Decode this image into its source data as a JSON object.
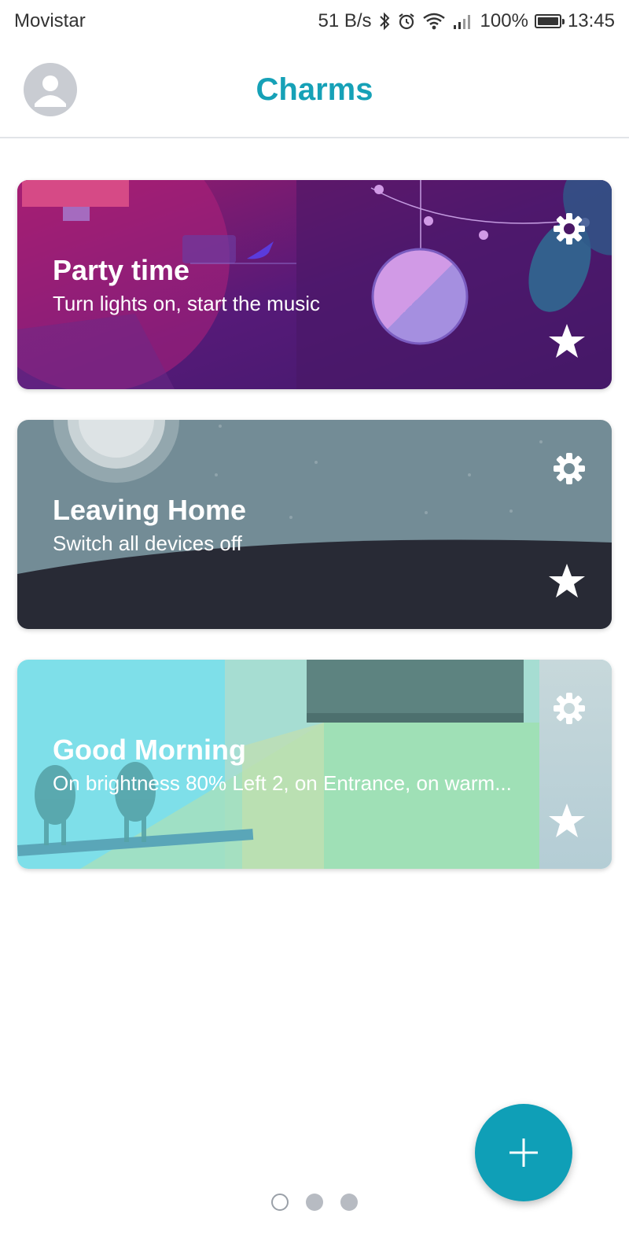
{
  "status_bar": {
    "carrier": "Movistar",
    "net_speed": "51 B/s",
    "battery": "100%",
    "time": "13:45",
    "icons": [
      "bluetooth-icon",
      "alarm-icon",
      "wifi-icon",
      "signal-icon",
      "battery-icon"
    ]
  },
  "header": {
    "title": "Charms",
    "avatar_icon": "user-avatar-icon"
  },
  "charms": [
    {
      "title": "Party time",
      "subtitle": "Turn lights on, start the music",
      "theme": "party"
    },
    {
      "title": "Leaving Home",
      "subtitle": "Switch all devices off",
      "theme": "night"
    },
    {
      "title": "Good Morning",
      "subtitle": "On  brightness 80% Left 2, on  Entrance, on warm...",
      "theme": "morning"
    }
  ],
  "card_icons": {
    "settings": "gear-icon",
    "favorite": "star-icon"
  },
  "fab": {
    "icon": "plus-icon"
  },
  "pager": {
    "pages": 3,
    "active": 1
  },
  "colors": {
    "accent": "#16a1b7",
    "fab": "#0f9fb7",
    "party": "#5a1f7a",
    "night": "#738c96",
    "morning": "#8ee0c8"
  }
}
